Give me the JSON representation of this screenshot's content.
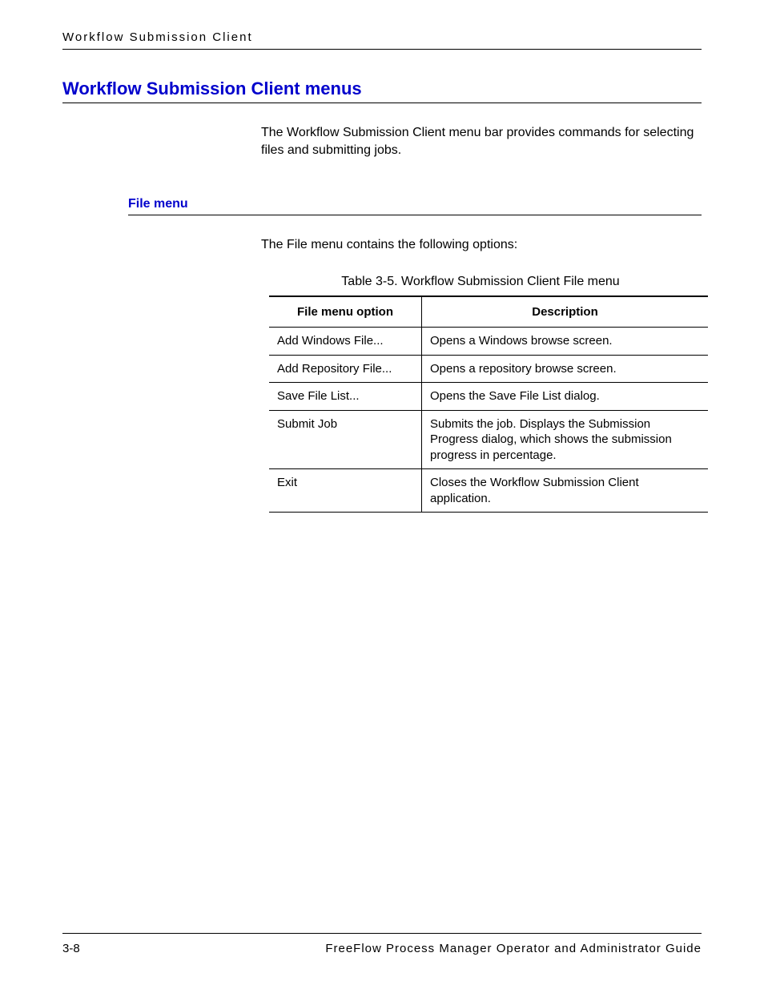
{
  "header": {
    "running_head": "Workflow Submission Client"
  },
  "section": {
    "title": "Workflow Submission Client menus",
    "intro": "The Workflow Submission Client menu bar provides commands for selecting files and submitting jobs."
  },
  "subsection": {
    "title": "File menu",
    "intro": "The File menu contains the following options:",
    "table_caption": "Table 3-5. Workflow Submission Client File menu",
    "columns": {
      "c0": "File menu option",
      "c1": "Description"
    },
    "rows": [
      {
        "option": "Add Windows File...",
        "desc": "Opens a Windows browse screen."
      },
      {
        "option": "Add Repository File...",
        "desc": "Opens a repository browse screen."
      },
      {
        "option": "Save File List...",
        "desc": "Opens the Save File List dialog."
      },
      {
        "option": "Submit Job",
        "desc": "Submits the job. Displays the Submission Progress dialog, which shows the submission progress in percentage."
      },
      {
        "option": "Exit",
        "desc": "Closes the Workflow Submission Client application."
      }
    ]
  },
  "footer": {
    "page_number": "3-8",
    "doc_title": "FreeFlow Process Manager Operator and Administrator Guide"
  }
}
